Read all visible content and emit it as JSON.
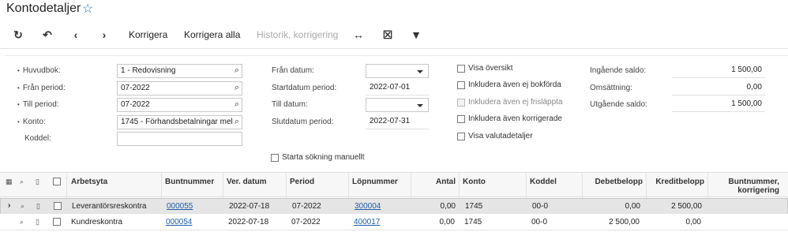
{
  "header": {
    "title": "Kontodetaljer",
    "favorite_icon": "star-outline-icon"
  },
  "toolbar": {
    "refresh_icon": "refresh-icon",
    "undo_icon": "undo-icon",
    "prev_icon": "chevron-left-icon",
    "next_icon": "chevron-right-icon",
    "korrigera": "Korrigera",
    "korrigera_alla": "Korrigera alla",
    "historik": "Historik, korrigering",
    "fit_icon": "fit-columns-icon",
    "clear_icon": "clear-filter-icon",
    "filter_icon": "filter-icon"
  },
  "form": {
    "huvudbok_label": "Huvudbok:",
    "huvudbok_value": "1 - Redovisning",
    "fran_period_label": "Från period:",
    "fran_period_value": "07-2022",
    "till_period_label": "Till period:",
    "till_period_value": "07-2022",
    "konto_label": "Konto:",
    "konto_value": "1745 - Förhandsbetalningar mel",
    "koddel_label": "Koddel:",
    "koddel_value": "",
    "fran_datum_label": "Från datum:",
    "fran_datum_value": "",
    "startdatum_label": "Startdatum period:",
    "startdatum_value": "2022-07-01",
    "till_datum_label": "Till datum:",
    "till_datum_value": "",
    "slutdatum_label": "Slutdatum period:",
    "slutdatum_value": "2022-07-31",
    "starta_sokning": "Starta sökning manuellt",
    "visa_oversikt": "Visa översikt",
    "inkl_ej_bokforda": "Inkludera även ej bokförda",
    "inkl_ej_frislappta": "Inkludera även ej frisläppta",
    "inkl_korrigerade": "Inkludera även korrigerade",
    "visa_valuta": "Visa valutadetaljer",
    "ingaende_label": "Ingående saldo:",
    "ingaende_value": "1 500,00",
    "omsattning_label": "Omsättning:",
    "omsattning_value": "0,00",
    "utgaende_label": "Utgående saldo:",
    "utgaende_value": "1 500,00"
  },
  "grid": {
    "columns": {
      "arbetsyta": "Arbetsyta",
      "buntnummer": "Buntnummer",
      "ver_datum": "Ver. datum",
      "period": "Period",
      "lopnummer": "Löpnummer",
      "antal": "Antal",
      "konto": "Konto",
      "koddel": "Koddel",
      "debet": "Debetbelopp",
      "kredit": "Kreditbelopp",
      "bunt_korr_1": "Buntnummer,",
      "bunt_korr_2": "korrigering"
    },
    "rows": [
      {
        "arbetsyta": "Leverantörsreskontra",
        "buntnummer": "000055",
        "ver_datum": "2022-07-18",
        "period": "07-2022",
        "lopnummer": "300004",
        "antal": "0,00",
        "konto": "1745",
        "koddel": "00-0",
        "debet": "0,00",
        "kredit": "2 500,00"
      },
      {
        "arbetsyta": "Kundreskontra",
        "buntnummer": "000054",
        "ver_datum": "2022-07-18",
        "period": "07-2022",
        "lopnummer": "400017",
        "antal": "0,00",
        "konto": "1745",
        "koddel": "00-0",
        "debet": "2 500,00",
        "kredit": "0,00"
      }
    ]
  }
}
